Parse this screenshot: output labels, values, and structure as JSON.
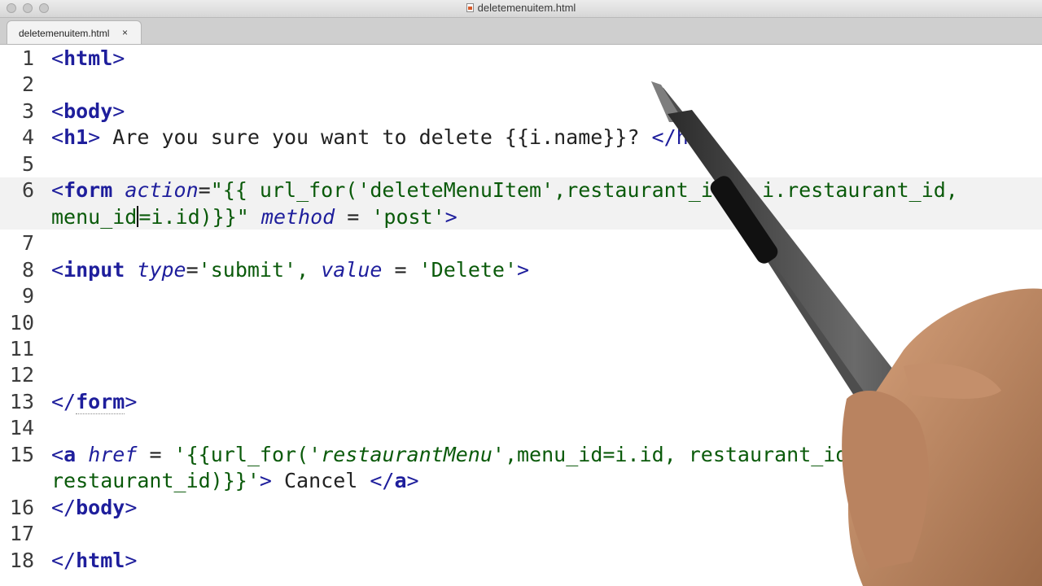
{
  "window": {
    "title": "deletemenuitem.html"
  },
  "tab": {
    "label": "deletemenuitem.html",
    "close": "×"
  },
  "line_numbers": [
    "1",
    "2",
    "3",
    "4",
    "5",
    "6",
    "7",
    "8",
    "9",
    "10",
    "11",
    "12",
    "13",
    "14",
    "15",
    "16",
    "17",
    "18"
  ],
  "code": {
    "l1": {
      "lt": "<",
      "tag": "html",
      "gt": ">"
    },
    "l3": {
      "lt": "<",
      "tag": "body",
      "gt": ">"
    },
    "l4": {
      "lt": "<",
      "tag": "h1",
      "gt": ">",
      "text": " Are you sure you want to delete {{i.name}}? ",
      "close": "</h1>"
    },
    "l6a": {
      "lt": "<",
      "tag": "form",
      "sp": " ",
      "attr": "action",
      "eq": "=",
      "val": "\"{{ url_for('deleteMenuItem',restaurant_id = i.restaurant_id,"
    },
    "l6b": {
      "val1": "menu_id",
      "val2": "=i.id)}}\"",
      "sp": " ",
      "attr": "method",
      "eq": " = ",
      "val3": "'post'",
      "gt": ">"
    },
    "l8": {
      "lt": "<",
      "tag": "input",
      "sp": " ",
      "attr1": "type",
      "eq1": "=",
      "val1": "'submit', ",
      "attr2": "value",
      "eq2": " = ",
      "val2": "'Delete'",
      "gt": ">"
    },
    "l13": {
      "lt": "</",
      "tag": "form",
      "gt": ">"
    },
    "l15a": {
      "lt": "<",
      "tag": "a",
      "sp": " ",
      "attr": "href",
      "eq": " = ",
      "val1": "'{{url_for('",
      "val2": "restaurantMenu",
      "val3": "',menu_id=i.id, restaurant_id = i."
    },
    "l15b": {
      "val": "restaurant_id)}}'",
      "gt": ">",
      "text": " Cancel ",
      "lt2": "</",
      "tag": "a",
      "gt2": ">"
    },
    "l16": {
      "lt": "</",
      "tag": "body",
      "gt": ">"
    },
    "l18": {
      "lt": "</",
      "tag": "html",
      "gt": ">"
    }
  },
  "colors": {
    "tag": "#1e1e9c",
    "string": "#0a5a0a",
    "text": "#222222",
    "current_line": "#f2f2f2"
  }
}
